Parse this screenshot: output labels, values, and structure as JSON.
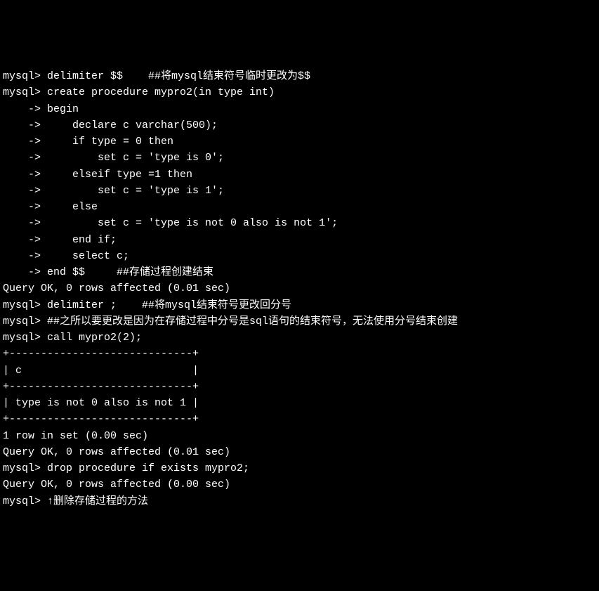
{
  "terminal": {
    "lines": [
      "mysql> delimiter $$    ##将mysql结束符号临时更改为$$",
      "mysql> create procedure mypro2(in type int)",
      "    -> begin",
      "    ->     declare c varchar(500);",
      "    ->     if type = 0 then",
      "    ->         set c = 'type is 0';",
      "    ->     elseif type =1 then",
      "    ->         set c = 'type is 1';",
      "    ->     else",
      "    ->         set c = 'type is not 0 also is not 1';",
      "    ->     end if;",
      "    ->     select c;",
      "    -> end $$     ##存储过程创建结束",
      "Query OK, 0 rows affected (0.01 sec)",
      "",
      "mysql> delimiter ;    ##将mysql结束符号更改回分号",
      "mysql> ##之所以要更改是因为在存储过程中分号是sql语句的结束符号，无法使用分号结束创建",
      "mysql> call mypro2(2);",
      "+-----------------------------+",
      "| c                           |",
      "+-----------------------------+",
      "| type is not 0 also is not 1 |",
      "+-----------------------------+",
      "1 row in set (0.00 sec)",
      "",
      "Query OK, 0 rows affected (0.01 sec)",
      "",
      "mysql> drop procedure if exists mypro2;",
      "Query OK, 0 rows affected (0.00 sec)",
      "",
      "mysql> ↑删除存储过程的方法"
    ]
  }
}
